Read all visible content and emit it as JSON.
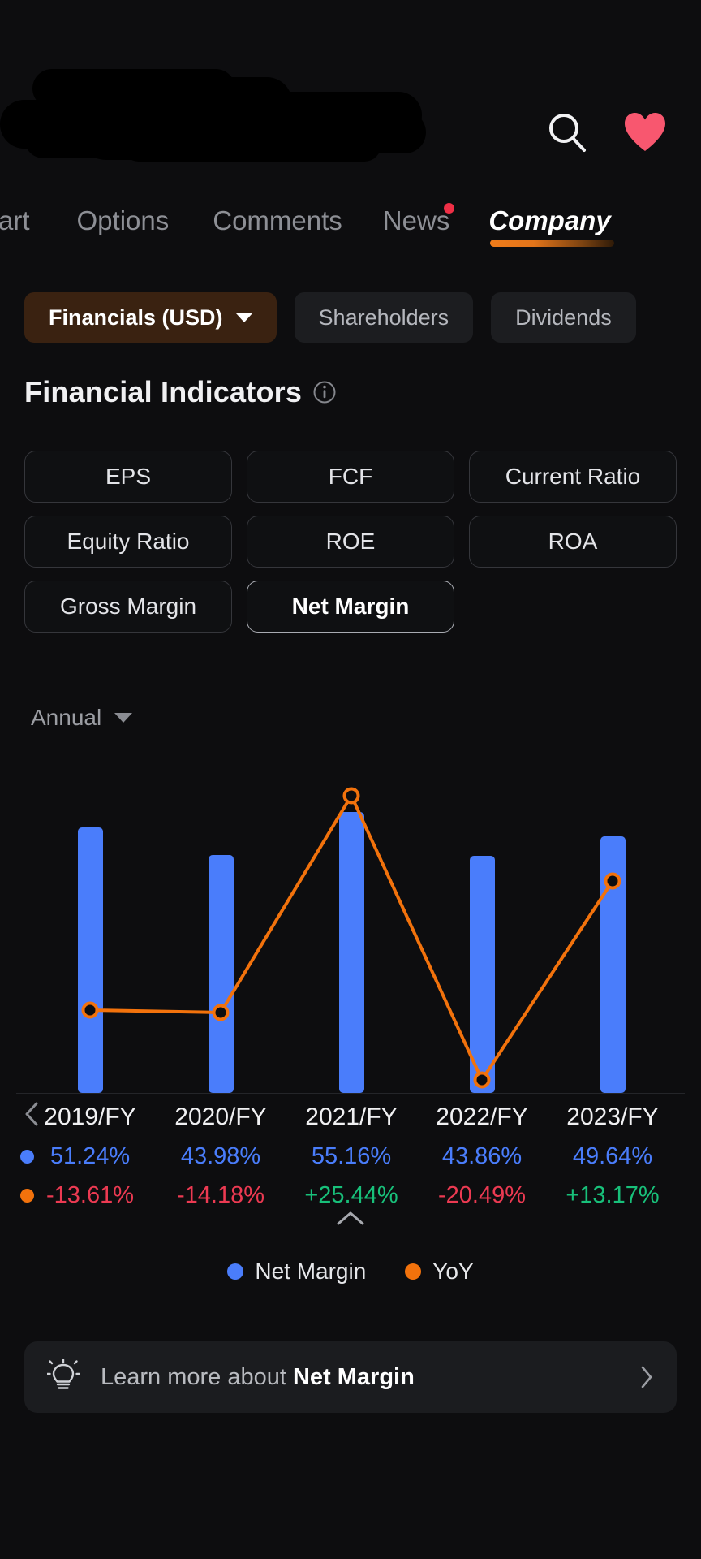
{
  "header": {
    "title_redacted": true,
    "search_icon": "search-icon",
    "favorite_icon": "heart-icon",
    "favorite_color": "#f8576f"
  },
  "tabs": [
    {
      "label": "art",
      "active": false,
      "badge": false,
      "truncated": true
    },
    {
      "label": "Options",
      "active": false,
      "badge": false
    },
    {
      "label": "Comments",
      "active": false,
      "badge": false
    },
    {
      "label": "News",
      "active": false,
      "badge": true
    },
    {
      "label": "Company",
      "active": true,
      "badge": false
    }
  ],
  "subtabs": [
    {
      "label": "Financials (USD)",
      "active": true,
      "caret": true
    },
    {
      "label": "Shareholders",
      "active": false,
      "caret": false
    },
    {
      "label": "Dividends",
      "active": false,
      "caret": false
    }
  ],
  "section": {
    "title": "Financial Indicators",
    "info_icon": "info-icon"
  },
  "indicators": [
    {
      "label": "EPS",
      "selected": false
    },
    {
      "label": "FCF",
      "selected": false
    },
    {
      "label": "Current Ratio",
      "selected": false
    },
    {
      "label": "Equity Ratio",
      "selected": false
    },
    {
      "label": "ROE",
      "selected": false
    },
    {
      "label": "ROA",
      "selected": false
    },
    {
      "label": "Gross Margin",
      "selected": false
    },
    {
      "label": "Net Margin",
      "selected": true
    }
  ],
  "period": {
    "label": "Annual",
    "caret": "chevron-down-icon"
  },
  "chart_data": {
    "type": "bar",
    "title": "Net Margin",
    "xlabel": "",
    "ylabel": "",
    "grid": false,
    "legend_position": "bottom",
    "categories": [
      "2019/FY",
      "2020/FY",
      "2021/FY",
      "2022/FY",
      "2023/FY"
    ],
    "series": [
      {
        "name": "Net Margin",
        "type": "bar",
        "color": "#4a7dfb",
        "values": [
          51.24,
          43.98,
          55.16,
          43.86,
          49.64
        ],
        "labels": [
          "51.24%",
          "43.98%",
          "55.16%",
          "43.86%",
          "49.64%"
        ],
        "ylim": [
          0,
          60
        ]
      },
      {
        "name": "YoY",
        "type": "line",
        "color": "#f2720c",
        "values": [
          -13.61,
          -14.18,
          25.44,
          -20.49,
          13.17
        ],
        "labels": [
          "-13.61%",
          "-14.18%",
          "+25.44%",
          "-20.49%",
          "+13.17%"
        ],
        "ylim": [
          -25,
          30
        ]
      }
    ]
  },
  "table": {
    "prev_arrow": "chevron-left-icon",
    "collapse_icon": "chevron-up-icon",
    "rows": [
      {
        "key": "years",
        "marker": null,
        "cells": [
          "2019/FY",
          "2020/FY",
          "2021/FY",
          "2022/FY",
          "2023/FY"
        ]
      },
      {
        "key": "net_margin",
        "marker": "#4a7dfb",
        "cells": [
          "51.24%",
          "43.98%",
          "55.16%",
          "43.86%",
          "49.64%"
        ]
      },
      {
        "key": "yoy",
        "marker": "#f2720c",
        "cells": [
          "-13.61%",
          "-14.18%",
          "+25.44%",
          "-20.49%",
          "+13.17%"
        ],
        "signs": [
          "neg",
          "neg",
          "pos",
          "neg",
          "pos"
        ]
      }
    ]
  },
  "legend": [
    {
      "label": "Net Margin",
      "color": "#4a7dfb"
    },
    {
      "label": "YoY",
      "color": "#f2720c"
    }
  ],
  "learn_card": {
    "icon": "lightbulb-icon",
    "prefix": "Learn more about ",
    "term": "Net Margin",
    "chevron": "chevron-right-icon"
  },
  "colors": {
    "background": "#0d0d0f",
    "bar": "#4a7dfb",
    "line": "#f2720c",
    "positive": "#18c07a",
    "negative": "#ec3a52",
    "accent": "#f07c1a"
  }
}
